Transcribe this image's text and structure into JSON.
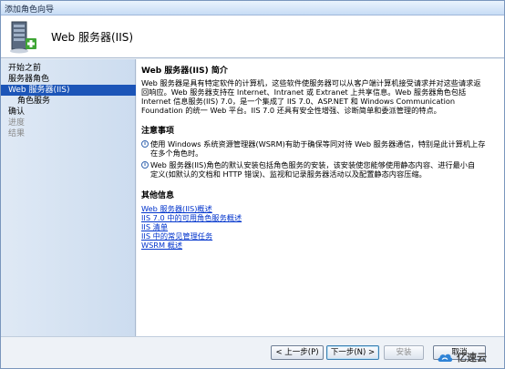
{
  "window": {
    "title": "添加角色向导"
  },
  "header": {
    "title": "Web 服务器(IIS)"
  },
  "sidebar": {
    "items": [
      {
        "label": "开始之前",
        "state": "normal"
      },
      {
        "label": "服务器角色",
        "state": "normal"
      },
      {
        "label": "Web 服务器(IIS)",
        "state": "active"
      },
      {
        "label": "角色服务",
        "state": "normal"
      },
      {
        "label": "确认",
        "state": "normal"
      },
      {
        "label": "进度",
        "state": "disabled"
      },
      {
        "label": "结果",
        "state": "disabled"
      }
    ]
  },
  "content": {
    "intro": {
      "title": "Web 服务器(IIS) 简介",
      "lines": [
        "Web 服务器是具有特定软件的计算机，这些软件使服务器可以从客户端计算机接受请求并对这些请求返",
        "回响应。Web 服务器支持在 Internet、Intranet 或 Extranet 上共享信息。Web 服务器角色包括",
        "Internet 信息服务(IIS) 7.0，是一个集成了 IIS 7.0、ASP.NET 和 Windows Communication",
        "Foundation 的统一 Web 平台。IIS 7.0 还具有安全性增强、诊断简单和委派管理的特点。"
      ]
    },
    "notes": {
      "title": "注意事项",
      "items": [
        {
          "lines": [
            "使用 Windows 系统资源管理器(WSRM)有助于确保等同对待 Web 服务器通信，特别是此计算机上存",
            "在多个角色时。"
          ]
        },
        {
          "lines": [
            "Web 服务器(IIS)角色的默认安装包括角色服务的安装，该安装使您能够使用静态内容、进行最小自",
            "定义(如默认的文档和 HTTP 错误)、监视和记录服务器活动以及配置静态内容压缩。"
          ]
        }
      ]
    },
    "more": {
      "title": "其他信息",
      "links": [
        "Web 服务器(IIS)概述",
        "IIS 7.0 中的可用角色服务概述",
        "IIS 清单",
        "IIS 中的常见管理任务",
        "WSRM 概述"
      ]
    }
  },
  "footer": {
    "prev_label": "< 上一步(P)",
    "next_label": "下一步(N) >",
    "install_label": "安装",
    "cancel_label": "取消"
  },
  "watermark": {
    "text": "亿速云"
  },
  "icons": {
    "info": "info-icon",
    "server": "server-icon",
    "watermark": "cloud-logo-icon"
  },
  "colors": {
    "active_nav": "#1c55b8",
    "link": "#0033cc",
    "title_bar": "#c7dcf5"
  }
}
